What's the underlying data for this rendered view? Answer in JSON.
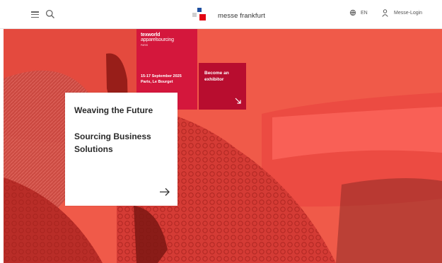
{
  "header": {
    "logo_text": "messe frankfurt",
    "language_label": "EN",
    "login_label": "Messe-Login",
    "icons": [
      "menu-icon",
      "search-icon",
      "globe-icon",
      "user-icon"
    ]
  },
  "event": {
    "brand_line_1": "texworld",
    "brand_line_2": "apparelsourcing",
    "brand_city": "PARIS",
    "dates": "15-17 September 2025",
    "location": "Paris, Le Bourget"
  },
  "cta": {
    "exhibitor_label": "Become an exhibitor"
  },
  "card": {
    "headline": "Weaving the Future",
    "subline": "Sourcing Business Solutions"
  },
  "colors": {
    "accent_red": "#d4173c",
    "dark_red": "#b80d2f",
    "hero_coral": "#f15a4a",
    "logo_blue": "#1e4fa0"
  }
}
